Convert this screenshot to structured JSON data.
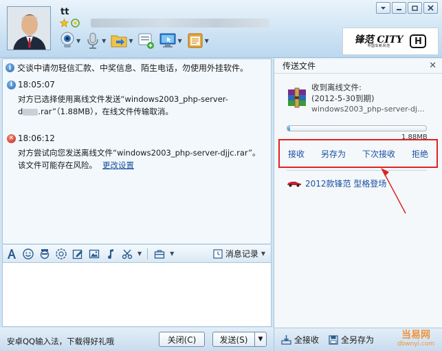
{
  "contact": {
    "nickname": "tt"
  },
  "window_controls": [
    "menu",
    "minimize",
    "maximize",
    "close"
  ],
  "ad_banner": {
    "brand": "锋范 CITY",
    "brand_sub": "中国车新风范"
  },
  "chat": {
    "warning": "交谈中请勿轻信汇款、中奖信息、陌生电话，勿使用外挂软件。",
    "messages": [
      {
        "time": "18:05:07",
        "line1": "对方已选择使用离线文件发送“windows2003_php-server-",
        "line2_prefix": "d",
        "line2_suffix": ".rar”（1.88MB），在线文件传输取消。"
      },
      {
        "time": "18:06:12",
        "line1": "对方尝试向您发送离线文件“windows2003_php-server-djjc.rar”。",
        "line2": "该文件可能存在风险。",
        "link": "更改设置"
      }
    ]
  },
  "chat_toolbar": {
    "record_label": "消息记录"
  },
  "bottom": {
    "promo": "安卓QQ输入法，下载得好礼哦",
    "close_label": "关闭(C)",
    "send_label": "发送(S)"
  },
  "transfer": {
    "title": "传送文件",
    "received_label": "收到离线文件:",
    "expiry": "(2012-5-30到期)",
    "filename": "windows2003_php-server-dj...",
    "size": "1.88MB",
    "progress": 0.01,
    "actions": [
      "接收",
      "另存为",
      "下次接收",
      "拒绝"
    ],
    "ad_text": "2012款锋范 型格登场",
    "footer": {
      "receive_all": "全接收",
      "save_all": "全另存为"
    }
  },
  "watermark": {
    "big": "当易网",
    "small": "dbwnyi.com"
  },
  "colors": {
    "highlight_border": "#e02020",
    "link": "#1a4fa0"
  }
}
